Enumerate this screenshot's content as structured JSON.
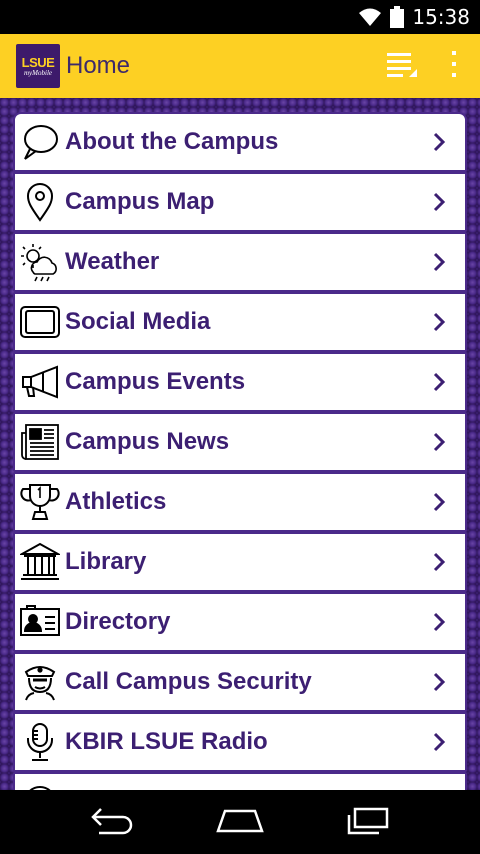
{
  "status_bar": {
    "time": "15:38",
    "icons": [
      "wifi-icon",
      "battery-icon"
    ]
  },
  "action_bar": {
    "logo_text": "LSUE",
    "logo_subtext": "myMobile",
    "title": "Home",
    "buttons": [
      "hamburger-menu-icon",
      "overflow-menu-icon"
    ]
  },
  "colors": {
    "accent_yellow": "#fdd023",
    "brand_purple": "#3c1f72"
  },
  "menu": {
    "items": [
      {
        "label": "About the Campus",
        "icon": "speech-bubble-icon"
      },
      {
        "label": "Campus Map",
        "icon": "map-pin-icon"
      },
      {
        "label": "Weather",
        "icon": "weather-icon"
      },
      {
        "label": "Social Media",
        "icon": "tablet-icon"
      },
      {
        "label": "Campus Events",
        "icon": "megaphone-icon"
      },
      {
        "label": "Campus News",
        "icon": "newspaper-icon"
      },
      {
        "label": "Athletics",
        "icon": "trophy-icon"
      },
      {
        "label": "Library",
        "icon": "library-icon"
      },
      {
        "label": "Directory",
        "icon": "id-card-icon"
      },
      {
        "label": "Call Campus Security",
        "icon": "police-icon"
      },
      {
        "label": "KBIR LSUE Radio",
        "icon": "microphone-icon"
      }
    ]
  },
  "nav_bar": {
    "buttons": [
      "back-icon",
      "home-icon",
      "recents-icon"
    ]
  }
}
